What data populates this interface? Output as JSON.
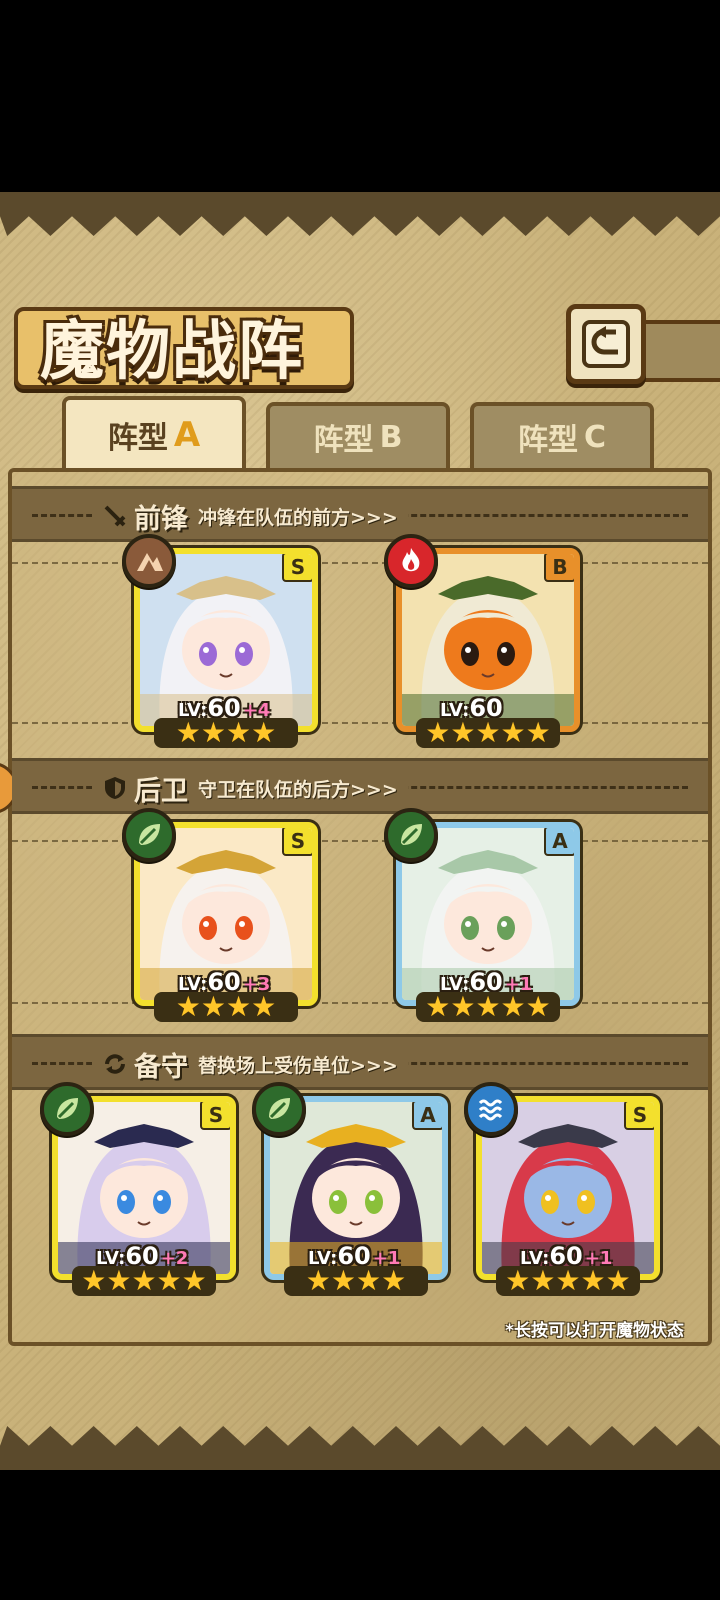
{
  "title": "魔物战阵",
  "tabs": [
    {
      "prefix": "阵型",
      "letter": "A",
      "active": true
    },
    {
      "prefix": "阵型",
      "letter": "B",
      "active": false
    },
    {
      "prefix": "阵型",
      "letter": "C",
      "active": false
    }
  ],
  "sections": {
    "vanguard": {
      "name": "前锋",
      "desc": "冲锋在队伍的前方>>>",
      "icon": "sword-icon"
    },
    "rearguard": {
      "name": "后卫",
      "desc": "守卫在队伍的后方>>>",
      "icon": "shield-icon"
    },
    "reserve": {
      "name": "备守",
      "desc": "替换场上受伤单位>>>",
      "icon": "swap-icon"
    }
  },
  "cards": {
    "v1": {
      "rank": "S",
      "element": "earth-icon",
      "element_color": "#8a5a3a",
      "lv_prefix": "LV:",
      "lv": "60",
      "bonus": "+4",
      "stars": 4,
      "frame_color": "#f3e02d",
      "art": "bunny-hat-girl"
    },
    "v2": {
      "rank": "B",
      "element": "fire-icon",
      "element_color": "#d8262b",
      "lv_prefix": "LV:",
      "lv": "60",
      "bonus": "",
      "stars": 5,
      "frame_color": "#e8902a",
      "art": "pumpkin-head"
    },
    "r1": {
      "rank": "S",
      "element": "leaf-icon",
      "element_color": "#2e6b2c",
      "lv_prefix": "LV:",
      "lv": "60",
      "bonus": "+3",
      "stars": 4,
      "frame_color": "#f3e02d",
      "art": "winged-knight"
    },
    "r2": {
      "rank": "A",
      "element": "leaf-icon",
      "element_color": "#2e6b2c",
      "lv_prefix": "LV:",
      "lv": "60",
      "bonus": "+1",
      "stars": 5,
      "frame_color": "#8ec9e8",
      "art": "white-priestess"
    },
    "b1": {
      "rank": "S",
      "element": "leaf-icon",
      "element_color": "#2e6b2c",
      "lv_prefix": "LV:",
      "lv": "60",
      "bonus": "+2",
      "stars": 5,
      "frame_color": "#f3e02d",
      "art": "horned-maid"
    },
    "b2": {
      "rank": "A",
      "element": "leaf-icon",
      "element_color": "#2e6b2c",
      "lv_prefix": "LV:",
      "lv": "60",
      "bonus": "+1",
      "stars": 4,
      "frame_color": "#8ec9e8",
      "art": "dark-fairy"
    },
    "b3": {
      "rank": "S",
      "element": "water-icon",
      "element_color": "#2f7fc8",
      "lv_prefix": "LV:",
      "lv": "60",
      "bonus": "+1",
      "stars": 5,
      "frame_color": "#f3e02d",
      "art": "red-hair-bunny"
    }
  },
  "footnote": "*长按可以打开魔物状态"
}
